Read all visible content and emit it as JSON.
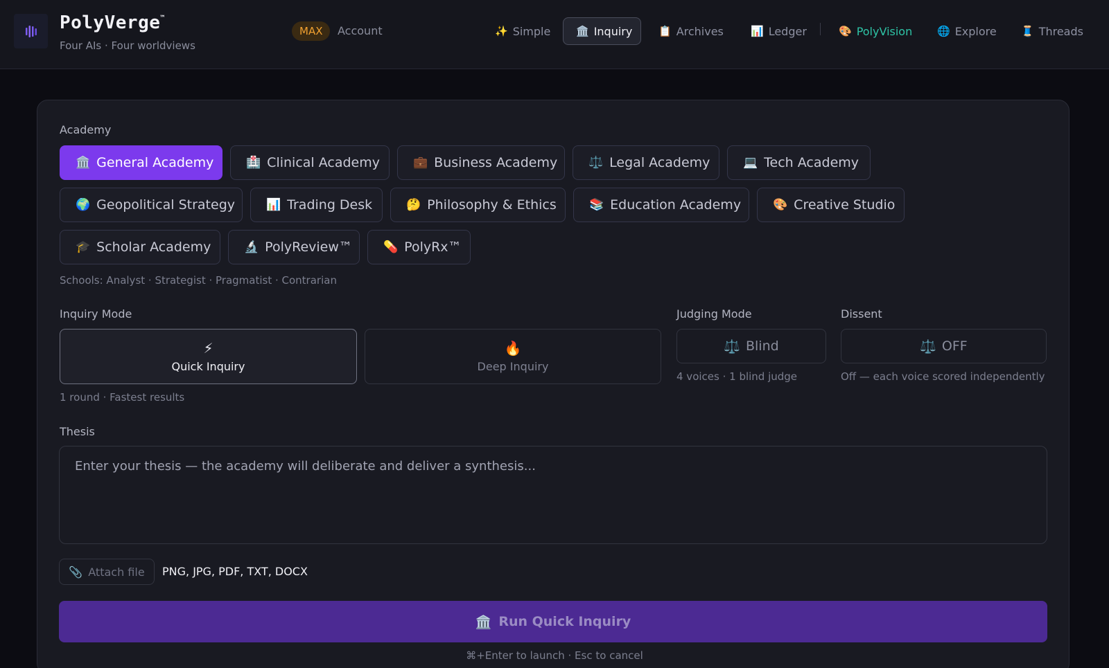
{
  "header": {
    "brand": "PolyVerge",
    "brand_mark": "™",
    "tagline": "Four AIs · Four worldviews",
    "plan_badge": "MAX",
    "account_label": "Account"
  },
  "nav": {
    "items": [
      {
        "icon": "✨",
        "label": "Simple"
      },
      {
        "icon": "🏛️",
        "label": "Inquiry"
      },
      {
        "icon": "📋",
        "label": "Archives"
      },
      {
        "icon": "📊",
        "label": "Ledger"
      },
      {
        "icon": "🎨",
        "label": "PolyVision"
      },
      {
        "icon": "🌐",
        "label": "Explore"
      },
      {
        "icon": "🧵",
        "label": "Threads"
      }
    ],
    "active": "Inquiry"
  },
  "academy": {
    "label": "Academy",
    "options": [
      {
        "icon": "🏛️",
        "label": "General Academy"
      },
      {
        "icon": "🏥",
        "label": "Clinical Academy"
      },
      {
        "icon": "💼",
        "label": "Business Academy"
      },
      {
        "icon": "⚖️",
        "label": "Legal Academy"
      },
      {
        "icon": "💻",
        "label": "Tech Academy"
      },
      {
        "icon": "🌍",
        "label": "Geopolitical Strategy"
      },
      {
        "icon": "📊",
        "label": "Trading Desk"
      },
      {
        "icon": "🤔",
        "label": "Philosophy & Ethics"
      },
      {
        "icon": "📚",
        "label": "Education Academy"
      },
      {
        "icon": "🎨",
        "label": "Creative Studio"
      },
      {
        "icon": "🎓",
        "label": "Scholar Academy"
      },
      {
        "icon": "🔬",
        "label": "PolyReview™"
      },
      {
        "icon": "💊",
        "label": "PolyRx™"
      }
    ],
    "selected": "General Academy",
    "schools_hint": "Schools: Analyst · Strategist · Pragmatist · Contrarian"
  },
  "inquiry_mode": {
    "label": "Inquiry Mode",
    "options": [
      {
        "icon": "⚡",
        "label": "Quick Inquiry"
      },
      {
        "icon": "🔥",
        "label": "Deep Inquiry"
      }
    ],
    "selected": "Quick Inquiry",
    "hint": "1 round · Fastest results"
  },
  "judging_mode": {
    "label": "Judging Mode",
    "icon": "⚖️",
    "value": "Blind",
    "hint": "4 voices · 1 blind judge"
  },
  "dissent": {
    "label": "Dissent",
    "icon": "⚖️",
    "value": "OFF",
    "hint": "Off — each voice scored independently"
  },
  "thesis": {
    "label": "Thesis",
    "placeholder": "Enter your thesis — the academy will deliberate and deliver a synthesis...",
    "value": ""
  },
  "attach": {
    "icon": "📎",
    "label": "Attach file",
    "file_types": "PNG, JPG, PDF, TXT, DOCX"
  },
  "run": {
    "icon": "🏛️",
    "label": "Run Quick Inquiry",
    "shortcut_hint": "⌘+Enter to launch · Esc to cancel"
  },
  "colors": {
    "accent": "#7c3aed",
    "run_button": "#4c2a93",
    "plan_badge_text": "#f0a030",
    "polyvision": "#2ec4a6",
    "background": "#0c0c12",
    "card": "#191a22"
  }
}
